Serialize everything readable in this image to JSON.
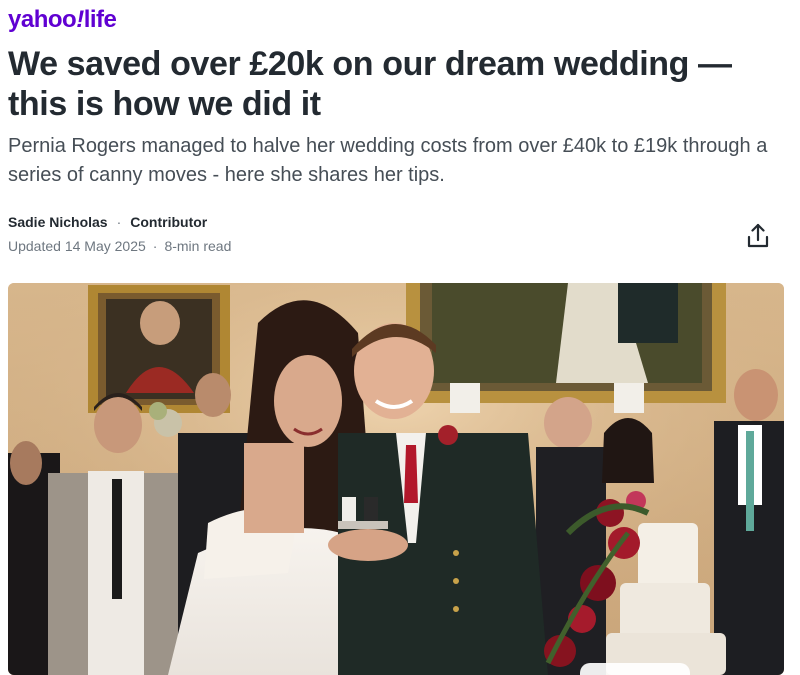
{
  "header": {
    "brand": "yahoo",
    "bang": "!",
    "section": "life",
    "brand_color": "#6001d2"
  },
  "article": {
    "headline": "We saved over £20k on our dream wedding — this is how we did it",
    "subhead": "Pernia Rogers managed to halve her wedding costs from over £40k to £19k through a series of canny moves - here she shares her tips.",
    "author": "Sadie Nicholas",
    "separator": "·",
    "role": "Contributor",
    "updated": "Updated 14 May 2025",
    "read_time": "8-min read"
  },
  "icons": {
    "share": "share-icon"
  },
  "hero": {
    "description_icon": "wedding-photo"
  }
}
